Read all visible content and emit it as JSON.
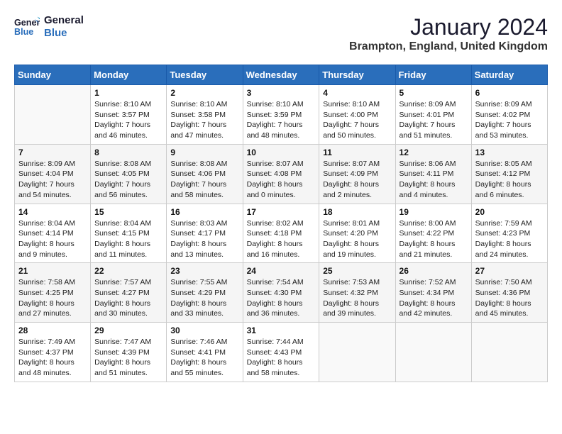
{
  "logo": {
    "line1": "General",
    "line2": "Blue"
  },
  "title": "January 2024",
  "location": "Brampton, England, United Kingdom",
  "days_of_week": [
    "Sunday",
    "Monday",
    "Tuesday",
    "Wednesday",
    "Thursday",
    "Friday",
    "Saturday"
  ],
  "weeks": [
    [
      {
        "num": "",
        "info": ""
      },
      {
        "num": "1",
        "info": "Sunrise: 8:10 AM\nSunset: 3:57 PM\nDaylight: 7 hours\nand 46 minutes."
      },
      {
        "num": "2",
        "info": "Sunrise: 8:10 AM\nSunset: 3:58 PM\nDaylight: 7 hours\nand 47 minutes."
      },
      {
        "num": "3",
        "info": "Sunrise: 8:10 AM\nSunset: 3:59 PM\nDaylight: 7 hours\nand 48 minutes."
      },
      {
        "num": "4",
        "info": "Sunrise: 8:10 AM\nSunset: 4:00 PM\nDaylight: 7 hours\nand 50 minutes."
      },
      {
        "num": "5",
        "info": "Sunrise: 8:09 AM\nSunset: 4:01 PM\nDaylight: 7 hours\nand 51 minutes."
      },
      {
        "num": "6",
        "info": "Sunrise: 8:09 AM\nSunset: 4:02 PM\nDaylight: 7 hours\nand 53 minutes."
      }
    ],
    [
      {
        "num": "7",
        "info": "Sunrise: 8:09 AM\nSunset: 4:04 PM\nDaylight: 7 hours\nand 54 minutes."
      },
      {
        "num": "8",
        "info": "Sunrise: 8:08 AM\nSunset: 4:05 PM\nDaylight: 7 hours\nand 56 minutes."
      },
      {
        "num": "9",
        "info": "Sunrise: 8:08 AM\nSunset: 4:06 PM\nDaylight: 7 hours\nand 58 minutes."
      },
      {
        "num": "10",
        "info": "Sunrise: 8:07 AM\nSunset: 4:08 PM\nDaylight: 8 hours\nand 0 minutes."
      },
      {
        "num": "11",
        "info": "Sunrise: 8:07 AM\nSunset: 4:09 PM\nDaylight: 8 hours\nand 2 minutes."
      },
      {
        "num": "12",
        "info": "Sunrise: 8:06 AM\nSunset: 4:11 PM\nDaylight: 8 hours\nand 4 minutes."
      },
      {
        "num": "13",
        "info": "Sunrise: 8:05 AM\nSunset: 4:12 PM\nDaylight: 8 hours\nand 6 minutes."
      }
    ],
    [
      {
        "num": "14",
        "info": "Sunrise: 8:04 AM\nSunset: 4:14 PM\nDaylight: 8 hours\nand 9 minutes."
      },
      {
        "num": "15",
        "info": "Sunrise: 8:04 AM\nSunset: 4:15 PM\nDaylight: 8 hours\nand 11 minutes."
      },
      {
        "num": "16",
        "info": "Sunrise: 8:03 AM\nSunset: 4:17 PM\nDaylight: 8 hours\nand 13 minutes."
      },
      {
        "num": "17",
        "info": "Sunrise: 8:02 AM\nSunset: 4:18 PM\nDaylight: 8 hours\nand 16 minutes."
      },
      {
        "num": "18",
        "info": "Sunrise: 8:01 AM\nSunset: 4:20 PM\nDaylight: 8 hours\nand 19 minutes."
      },
      {
        "num": "19",
        "info": "Sunrise: 8:00 AM\nSunset: 4:22 PM\nDaylight: 8 hours\nand 21 minutes."
      },
      {
        "num": "20",
        "info": "Sunrise: 7:59 AM\nSunset: 4:23 PM\nDaylight: 8 hours\nand 24 minutes."
      }
    ],
    [
      {
        "num": "21",
        "info": "Sunrise: 7:58 AM\nSunset: 4:25 PM\nDaylight: 8 hours\nand 27 minutes."
      },
      {
        "num": "22",
        "info": "Sunrise: 7:57 AM\nSunset: 4:27 PM\nDaylight: 8 hours\nand 30 minutes."
      },
      {
        "num": "23",
        "info": "Sunrise: 7:55 AM\nSunset: 4:29 PM\nDaylight: 8 hours\nand 33 minutes."
      },
      {
        "num": "24",
        "info": "Sunrise: 7:54 AM\nSunset: 4:30 PM\nDaylight: 8 hours\nand 36 minutes."
      },
      {
        "num": "25",
        "info": "Sunrise: 7:53 AM\nSunset: 4:32 PM\nDaylight: 8 hours\nand 39 minutes."
      },
      {
        "num": "26",
        "info": "Sunrise: 7:52 AM\nSunset: 4:34 PM\nDaylight: 8 hours\nand 42 minutes."
      },
      {
        "num": "27",
        "info": "Sunrise: 7:50 AM\nSunset: 4:36 PM\nDaylight: 8 hours\nand 45 minutes."
      }
    ],
    [
      {
        "num": "28",
        "info": "Sunrise: 7:49 AM\nSunset: 4:37 PM\nDaylight: 8 hours\nand 48 minutes."
      },
      {
        "num": "29",
        "info": "Sunrise: 7:47 AM\nSunset: 4:39 PM\nDaylight: 8 hours\nand 51 minutes."
      },
      {
        "num": "30",
        "info": "Sunrise: 7:46 AM\nSunset: 4:41 PM\nDaylight: 8 hours\nand 55 minutes."
      },
      {
        "num": "31",
        "info": "Sunrise: 7:44 AM\nSunset: 4:43 PM\nDaylight: 8 hours\nand 58 minutes."
      },
      {
        "num": "",
        "info": ""
      },
      {
        "num": "",
        "info": ""
      },
      {
        "num": "",
        "info": ""
      }
    ]
  ]
}
